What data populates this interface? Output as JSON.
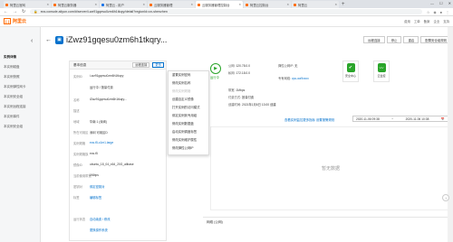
{
  "browser": {
    "tabs": [
      {
        "label": "阿里云官网",
        "color": "#ff6a00"
      },
      {
        "label": "阿里云服务器",
        "color": "#ff6a00"
      },
      {
        "label": "阿里云 - 用户",
        "color": "#1a73e8"
      },
      {
        "label": "云服务器管理",
        "color": "#ff6a00"
      },
      {
        "label": "云服务器管理控制台",
        "color": "#ff6a00",
        "active": true
      },
      {
        "label": "阿里云控制台",
        "color": "#ff6a00"
      },
      {
        "label": "阿里云",
        "color": "#ff6a00"
      }
    ],
    "url": "ecs.console.aliyun.com/#/server/i-wz91gqesu0zm6h1tkqry/detail?regionId=cn-shenzhen"
  },
  "console": {
    "logo_box": "[-]",
    "logo_text": "阿里云",
    "top_links": [
      "费用",
      "工单",
      "备案",
      "企业",
      "支持"
    ]
  },
  "sidebar": {
    "head": "实例详情",
    "items": [
      "本实例磁盘",
      "本实例快照",
      "本实例弹性网卡",
      "本实例安全组",
      "本实例远程连接",
      "本实例事件",
      "本实例安全组"
    ]
  },
  "title": {
    "instance_name": "iZwz91gqesu0zm6h1tkqry...",
    "actions": [
      "远程连接",
      "停止",
      "重启",
      "配置安全组规则"
    ]
  },
  "basic": {
    "heading": "基本信息",
    "link_remote": "远程连接",
    "link_more": "更多",
    "rows": [
      {
        "k": "实例ID",
        "v": "i-wz91gqesu0zm6h1tkqry"
      },
      {
        "k": "",
        "v": "运行中 / 按量付费"
      },
      {
        "k": "名称",
        "v": "iZwz91gqesu0zm6h1tkqry..."
      },
      {
        "k": "描述",
        "v": ""
      },
      {
        "k": "地域",
        "v": "华南 1 (深圳)"
      },
      {
        "k": "所在可用区",
        "v": "深圳 可用区D"
      },
      {
        "k": "实例规格",
        "v": "ecs.t5-c1m1.large",
        "link": true
      },
      {
        "k": "实例规格族",
        "v": "ecs.t5"
      },
      {
        "k": "镜像ID",
        "v": "ubuntu_18_04_x64_20G_alibase"
      },
      {
        "k": "当前使用带宽",
        "v": "1Mbps"
      },
      {
        "k": "密钥对",
        "v": "绑定密钥对",
        "link": true
      },
      {
        "k": "标签",
        "v": "编辑标签",
        "link": true
      },
      {
        "k": "",
        "v": ""
      },
      {
        "k": "运行状态",
        "v": "自动续费 / 修改"
      },
      {
        "k": "",
        "v": "更换操作系统"
      }
    ]
  },
  "dropdown": {
    "items": [
      {
        "label": "重置实例密码",
        "disabled": false
      },
      {
        "label": "修改实例名称",
        "disabled": false
      },
      {
        "label": "修改实例规格",
        "disabled": true
      },
      {
        "label": "创建自定义镜像",
        "disabled": false
      },
      {
        "label": "打开实例的访问模式",
        "disabled": false
      },
      {
        "label": "绑定实例到专用组",
        "disabled": false
      },
      {
        "label": "修改实例数据盘",
        "disabled": false
      },
      {
        "label": "启动实例调度标签",
        "disabled": false
      },
      {
        "label": "修改实例维护属性",
        "disabled": false
      },
      {
        "label": "修改弹性公网IP",
        "disabled": false
      }
    ]
  },
  "status": {
    "state": "运行中",
    "fields": [
      {
        "label": "公网:",
        "value": "120.78.0.0"
      },
      {
        "label": "私网:",
        "value": "172.18.0.0"
      },
      {
        "label": "弹性公网IP:",
        "value": "无"
      },
      {
        "label": "专有网络:",
        "value": "vpc-wz9xxxx",
        "link": true
      },
      {
        "label": "带宽:",
        "value": "1Mbps"
      },
      {
        "label": "付费方式:",
        "value": "按量付费"
      },
      {
        "label": "创建时间:",
        "value": "2021年1月6日 13:00 创建"
      }
    ]
  },
  "security": {
    "items": [
      {
        "label": "安全中心",
        "color": "#2aa52a",
        "icon": "shield-icon"
      },
      {
        "label": "云监控",
        "color": "#2aa52a",
        "icon": "monitor-icon"
      }
    ]
  },
  "monitor": {
    "link": "查看实例监控更多指标 设置报警规则",
    "date_start": "2020-11-06 09:38",
    "date_sep": "~",
    "date_end": "2020-11-06 10:38",
    "empty_text": "暂无数据",
    "net_heading": "网络 (公网)"
  }
}
